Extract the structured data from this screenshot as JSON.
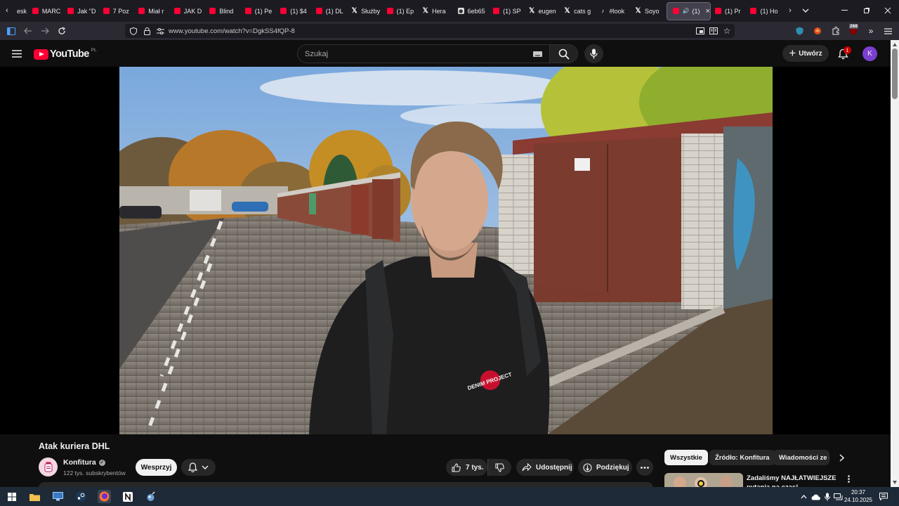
{
  "browser": {
    "tabs": [
      {
        "label": "esk",
        "icon": "partial-tab"
      },
      {
        "label": "MARC",
        "icon": "youtube"
      },
      {
        "label": "Jak \"D",
        "icon": "youtube"
      },
      {
        "label": "7 Poz",
        "icon": "youtube"
      },
      {
        "label": "Miał r",
        "icon": "youtube"
      },
      {
        "label": "JAK D",
        "icon": "youtube"
      },
      {
        "label": "Blind",
        "icon": "youtube"
      },
      {
        "label": "(1) Pe",
        "icon": "youtube"
      },
      {
        "label": "(1) $4",
        "icon": "youtube"
      },
      {
        "label": "(1) DL",
        "icon": "youtube"
      },
      {
        "label": "Służby",
        "icon": "x"
      },
      {
        "label": "(1) Ep",
        "icon": "youtube"
      },
      {
        "label": "Hera",
        "icon": "x"
      },
      {
        "label": "6eb65",
        "icon": "github"
      },
      {
        "label": "(1) SP",
        "icon": "youtube"
      },
      {
        "label": "eugen",
        "icon": "x"
      },
      {
        "label": "cats g",
        "icon": "x"
      },
      {
        "label": "#look",
        "icon": "tiktok"
      },
      {
        "label": "Soyo",
        "icon": "x"
      },
      {
        "label": "(1)",
        "icon": "youtube",
        "active": true
      },
      {
        "label": "(1) Pr",
        "icon": "youtube"
      },
      {
        "label": "(1) Ho",
        "icon": "youtube"
      }
    ],
    "url": "www.youtube.com/watch?v=DgkSS4fQP-8",
    "extension_badge": "268"
  },
  "youtube": {
    "logo_text": "YouTube",
    "region": "PL",
    "search_placeholder": "Szukaj",
    "create_label": "Utwórz",
    "notification_count": "1",
    "avatar_letter": "K",
    "accent": "#ff0033"
  },
  "video": {
    "shirt_text": "DENIM PROJECT"
  },
  "details": {
    "title": "Atak kuriera DHL",
    "channel_name": "Konfitura",
    "subscribers": "122 tys. subskrybentów",
    "support_label": "Wesprzyj",
    "likes": "7 tys.",
    "share_label": "Udostępnij",
    "thanks_label": "Podziękuj"
  },
  "chips": [
    "Wszystkie",
    "Źródło: Konfitura",
    "Wiadomości ze ś"
  ],
  "recommended": {
    "title_line1": "Zadaliśmy NAJŁATWIEJSZE",
    "title_line2": "pytania na czas!"
  },
  "taskbar": {
    "time": "20:37",
    "date": "24.10.2025"
  }
}
